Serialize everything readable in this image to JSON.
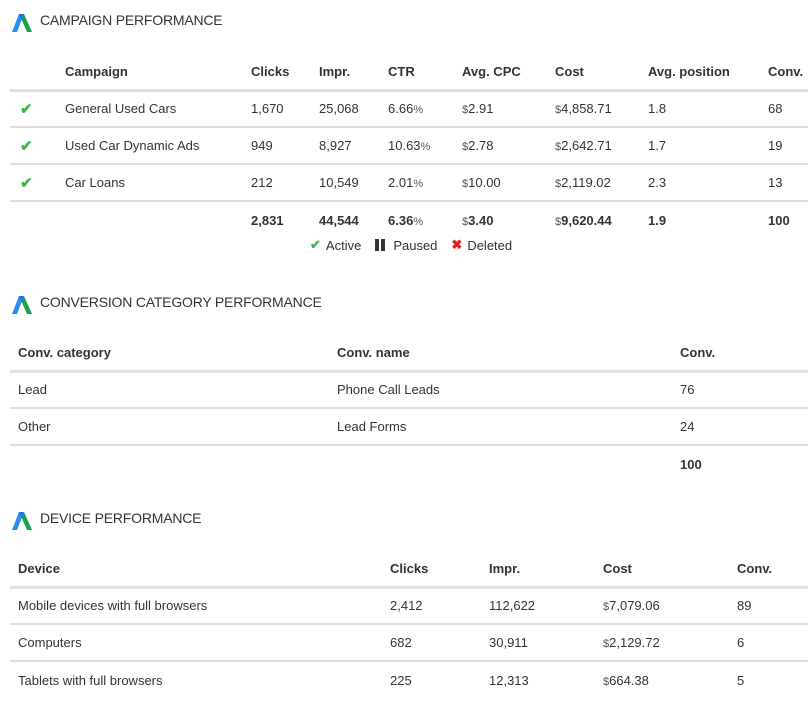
{
  "campaign_section": {
    "title": "CAMPAIGN PERFORMANCE",
    "icon": "google-ads-logo-icon",
    "headers": [
      "",
      "Campaign",
      "Clicks",
      "Impr.",
      "CTR",
      "Avg. CPC",
      "Cost",
      "Avg. position",
      "Conv."
    ],
    "rows": [
      {
        "status": "active",
        "status_icon": "check-icon",
        "campaign": "General Used Cars",
        "clicks": "1,670",
        "impr": "25,068",
        "ctr": "6.66",
        "avg_cpc": "2.91",
        "cost": "4,858.71",
        "avg_position": "1.8",
        "conv": "68"
      },
      {
        "status": "active",
        "status_icon": "check-icon",
        "campaign": "Used Car Dynamic Ads",
        "clicks": "949",
        "impr": "8,927",
        "ctr": "10.63",
        "avg_cpc": "2.78",
        "cost": "2,642.71",
        "avg_position": "1.7",
        "conv": "19"
      },
      {
        "status": "active",
        "status_icon": "check-icon",
        "campaign": "Car Loans",
        "clicks": "212",
        "impr": "10,549",
        "ctr": "2.01",
        "avg_cpc": "10.00",
        "cost": "2,119.02",
        "avg_position": "2.3",
        "conv": "13"
      }
    ],
    "totals": {
      "clicks": "2,831",
      "impr": "44,544",
      "ctr": "6.36",
      "avg_cpc": "3.40",
      "cost": "9,620.44",
      "avg_position": "1.9",
      "conv": "100"
    },
    "currency_symbol": "$",
    "percent_symbol": "%",
    "legend": [
      {
        "label": "Active",
        "icon": "check-icon",
        "color": "#3cb54a"
      },
      {
        "label": "Paused",
        "icon": "pause-icon",
        "color": "#333333"
      },
      {
        "label": "Deleted",
        "icon": "x-icon",
        "color": "#e02020"
      }
    ]
  },
  "conversion_section": {
    "title": "CONVERSION CATEGORY PERFORMANCE",
    "icon": "google-ads-logo-icon",
    "headers": [
      "Conv. category",
      "Conv. name",
      "Conv."
    ],
    "rows": [
      {
        "category": "Lead",
        "name": "Phone Call Leads",
        "conv": "76"
      },
      {
        "category": "Other",
        "name": "Lead Forms",
        "conv": "24"
      }
    ],
    "total_conv": "100"
  },
  "device_section": {
    "title": "DEVICE PERFORMANCE",
    "icon": "google-ads-logo-icon",
    "headers": [
      "Device",
      "Clicks",
      "Impr.",
      "Cost",
      "Conv."
    ],
    "rows": [
      {
        "device": "Mobile devices with full browsers",
        "clicks": "2,412",
        "impr": "112,622",
        "cost": "7,079.06",
        "conv": "89"
      },
      {
        "device": "Computers",
        "clicks": "682",
        "impr": "30,911",
        "cost": "2,129.72",
        "conv": "6"
      },
      {
        "device": "Tablets with full browsers",
        "clicks": "225",
        "impr": "12,313",
        "cost": "664.38",
        "conv": "5"
      }
    ]
  },
  "colors": {
    "logo_blue": "#1a73e8",
    "logo_green": "#1e8e3e",
    "active_green": "#3cb54a",
    "deleted_red": "#e02020",
    "row_border": "#e0e0dc"
  }
}
